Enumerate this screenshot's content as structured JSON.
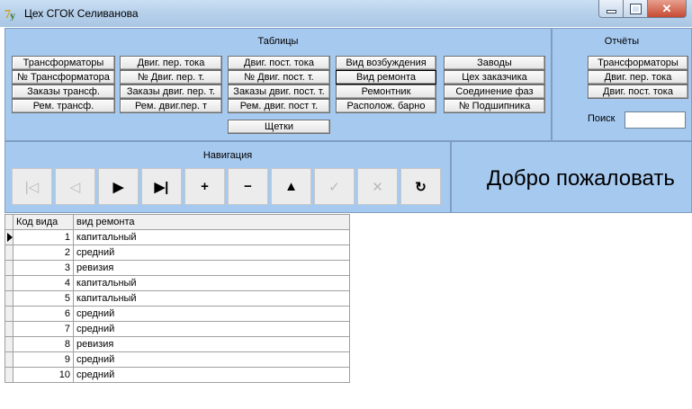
{
  "window": {
    "title": "Цех СГОК Селиванова"
  },
  "tables_panel": {
    "title": "Таблицы",
    "buttons": [
      "Трансформаторы",
      "№ Трансформатора",
      "Заказы трансф.",
      "Рем. трансф.",
      "Двиг. пер. тока",
      "№ Двиг. пер. т.",
      "Заказы двиг. пер. т.",
      "Рем. двиг.пер. т",
      "Двиг. пост. тока",
      "№ Двиг. пост. т.",
      "Заказы двиг. пост. т.",
      "Рем. двиг. пост т.",
      "Вид возбуждения",
      "Вид ремонта",
      "Ремонтник",
      "Располож. барно",
      "Заводы",
      "Цех заказчика",
      "Соединение фаз",
      "№ Подшипника",
      "Щетки"
    ]
  },
  "reports_panel": {
    "title": "Отчёты",
    "buttons": [
      "Трансформаторы",
      "Двиг. пер. тока",
      "Двиг. пост. тока"
    ],
    "search_label": "Поиск",
    "search_value": ""
  },
  "navigation": {
    "title": "Навигация",
    "buttons": [
      {
        "name": "first",
        "glyph": "|◁",
        "enabled": false
      },
      {
        "name": "prior",
        "glyph": "◁",
        "enabled": false
      },
      {
        "name": "next",
        "glyph": "▶",
        "enabled": true
      },
      {
        "name": "last",
        "glyph": "▶|",
        "enabled": true
      },
      {
        "name": "insert",
        "glyph": "+",
        "enabled": true
      },
      {
        "name": "delete",
        "glyph": "−",
        "enabled": true
      },
      {
        "name": "edit",
        "glyph": "▲",
        "enabled": true
      },
      {
        "name": "post",
        "glyph": "✓",
        "enabled": false
      },
      {
        "name": "cancel",
        "glyph": "✕",
        "enabled": false
      },
      {
        "name": "refresh",
        "glyph": "↻",
        "enabled": true
      }
    ]
  },
  "welcome_text": "Добро пожаловать",
  "grid": {
    "columns": [
      "Код вида",
      "вид ремонта"
    ],
    "rows": [
      [
        "1",
        "капитальный"
      ],
      [
        "2",
        "средний"
      ],
      [
        "3",
        "ревизия"
      ],
      [
        "4",
        "капитальный"
      ],
      [
        "5",
        "капитальный"
      ],
      [
        "6",
        "средний"
      ],
      [
        "7",
        "средний"
      ],
      [
        "8",
        "ревизия"
      ],
      [
        "9",
        "средний"
      ],
      [
        "10",
        "средний"
      ]
    ],
    "current_row": 0
  },
  "colors": {
    "panel": "#a6c9ef",
    "title_bar": "#b6d0ea",
    "close_button": "#c54a32"
  }
}
